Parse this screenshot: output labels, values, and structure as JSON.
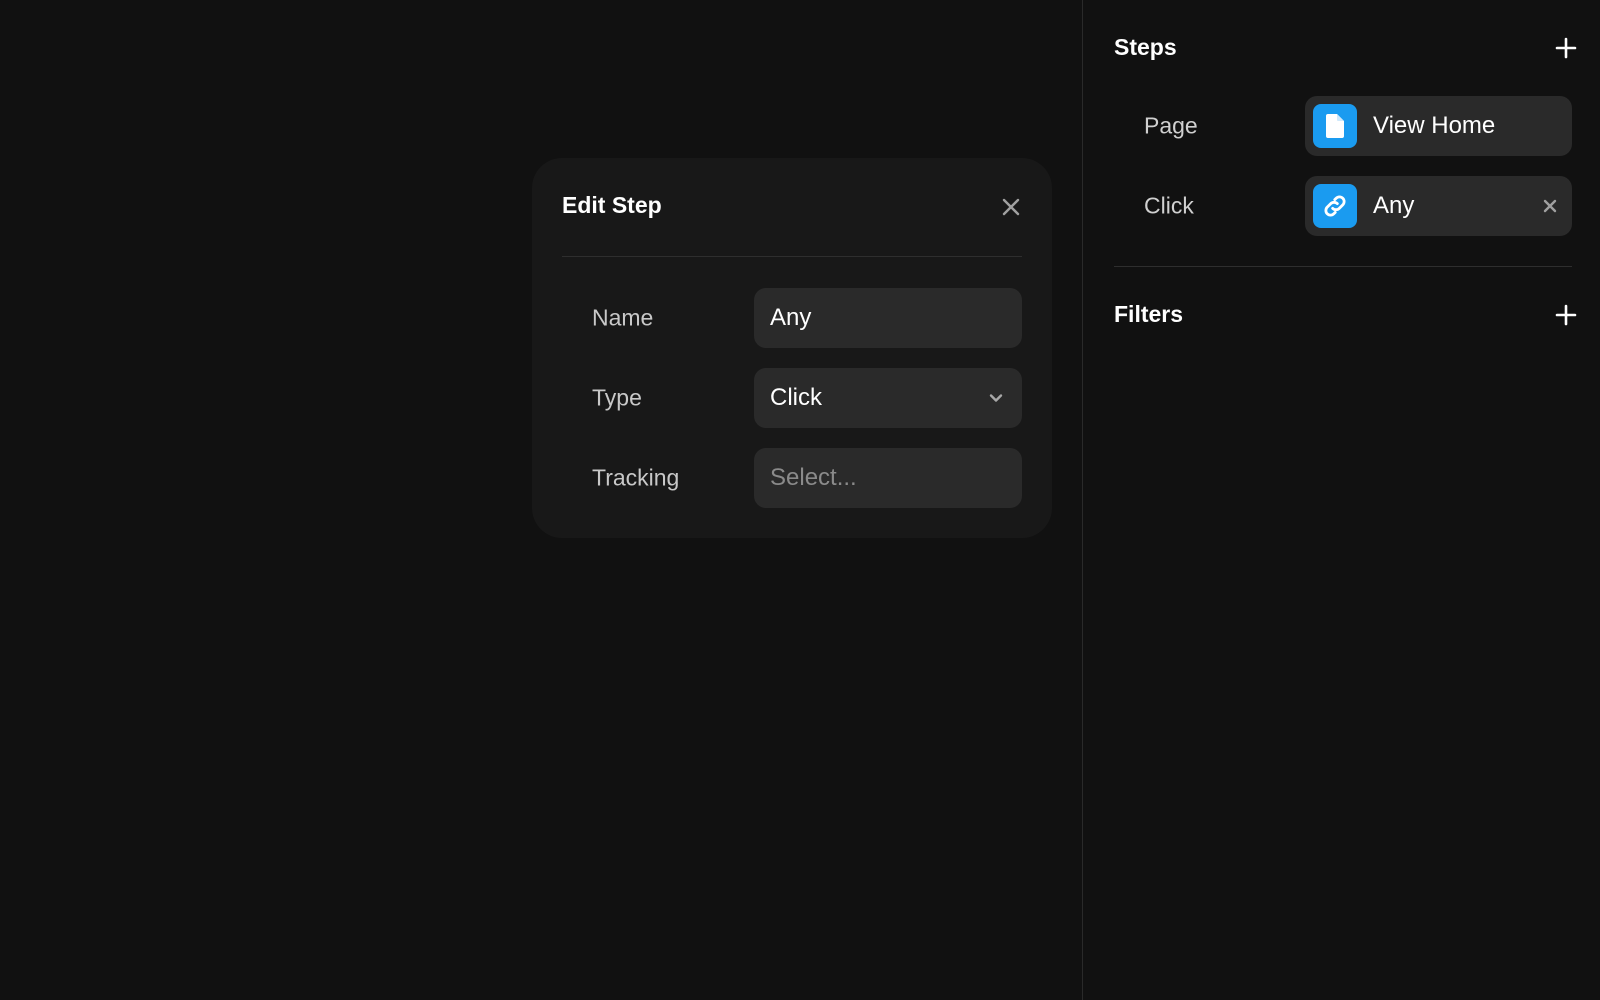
{
  "popup": {
    "title": "Edit Step",
    "fields": {
      "name": {
        "label": "Name",
        "value": "Any"
      },
      "type": {
        "label": "Type",
        "value": "Click"
      },
      "tracking": {
        "label": "Tracking",
        "placeholder": "Select..."
      }
    }
  },
  "sidebar": {
    "steps": {
      "title": "Steps",
      "items": [
        {
          "label": "Page",
          "value": "View Home",
          "icon": "page-icon"
        },
        {
          "label": "Click",
          "value": "Any",
          "icon": "link-icon"
        }
      ]
    },
    "filters": {
      "title": "Filters"
    }
  },
  "colors": {
    "accent": "#1a9bf0",
    "background": "#111111",
    "panel": "#181818",
    "field": "#2a2a2a"
  }
}
